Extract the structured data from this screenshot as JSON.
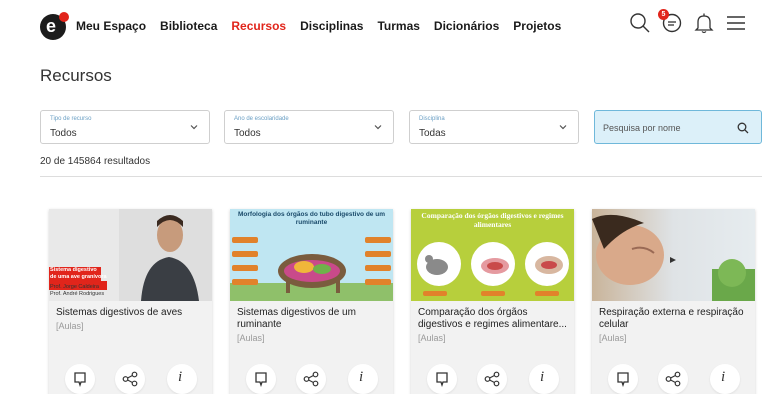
{
  "logo": {
    "letter": "e"
  },
  "nav": {
    "items": [
      {
        "label": "Meu Espaço"
      },
      {
        "label": "Biblioteca"
      },
      {
        "label": "Recursos",
        "active": true
      },
      {
        "label": "Disciplinas"
      },
      {
        "label": "Turmas"
      },
      {
        "label": "Dicionários"
      },
      {
        "label": "Projetos"
      }
    ]
  },
  "header_icons": {
    "search_icon": "search-icon",
    "messages_icon": "chat-icon",
    "messages_badge": "5",
    "notifications_icon": "bell-icon",
    "menu_icon": "hamburger-icon"
  },
  "page": {
    "title": "Recursos"
  },
  "filters": [
    {
      "label": "Tipo de recurso",
      "value": "Todos"
    },
    {
      "label": "Ano de escolaridade",
      "value": "Todos"
    },
    {
      "label": "Disciplina",
      "value": "Todas"
    }
  ],
  "search": {
    "placeholder": "Pesquisa por nome"
  },
  "results": {
    "text": "20 de 145864 resultados"
  },
  "cards": [
    {
      "title": "Sistemas digestivos de aves",
      "type": "[Aulas]",
      "thumb_lines": [
        "Sistema digestivo",
        "de uma ave granívora",
        "Prof. Jorge Caldeira",
        "Prof. André Rodrigues"
      ]
    },
    {
      "title": "Sistemas digestivos de um ruminante",
      "type": "[Aulas]",
      "thumb_heading": "Morfologia dos órgãos do tubo digestivo de um ruminante"
    },
    {
      "title": "Comparação dos órgãos digestivos e regimes alimentare...",
      "type": "[Aulas]",
      "thumb_heading": "Comparação dos órgãos digestivos e regimes alimentares"
    },
    {
      "title": "Respiração externa e respiração celular",
      "type": "[Aulas]"
    }
  ],
  "colors": {
    "accent": "#e1251b",
    "search_bg": "#dcf0f9",
    "card_bg": "#f2f2f2"
  }
}
